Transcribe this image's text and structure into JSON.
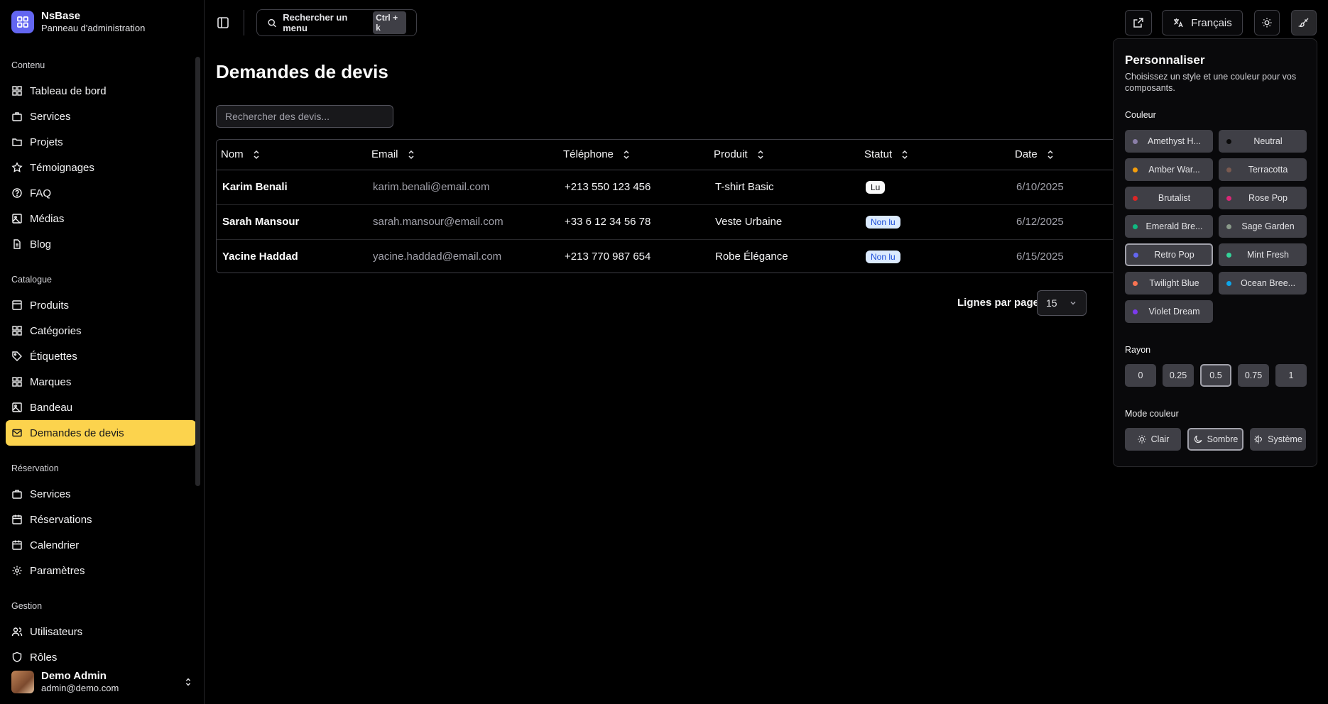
{
  "brand": {
    "title": "NsBase",
    "subtitle": "Panneau d'administration"
  },
  "nav": {
    "groups": [
      {
        "label": "Contenu",
        "items": [
          "Tableau de bord",
          "Services",
          "Projets",
          "Témoignages",
          "FAQ",
          "Médias",
          "Blog"
        ]
      },
      {
        "label": "Catalogue",
        "items": [
          "Produits",
          "Catégories",
          "Étiquettes",
          "Marques",
          "Bandeau",
          "Demandes de devis"
        ]
      },
      {
        "label": "Réservation",
        "items": [
          "Services",
          "Réservations",
          "Calendrier",
          "Paramètres"
        ]
      },
      {
        "label": "Gestion",
        "items": [
          "Utilisateurs",
          "Rôles"
        ]
      }
    ],
    "active": "Demandes de devis"
  },
  "user": {
    "name": "Demo Admin",
    "email": "admin@demo.com"
  },
  "topbar": {
    "search_label": "Rechercher un menu",
    "search_shortcut": "Ctrl + k",
    "language": "Français"
  },
  "main": {
    "title": "Demandes de devis",
    "search_placeholder": "Rechercher des devis...",
    "columns": [
      "Nom",
      "Email",
      "Téléphone",
      "Produit",
      "Statut",
      "Date"
    ],
    "rows": [
      {
        "name": "Karim Benali",
        "email": "karim.benali@email.com",
        "phone": "+213 550 123 456",
        "product": "T-shirt Basic",
        "status": "Lu",
        "date": "6/10/2025"
      },
      {
        "name": "Sarah Mansour",
        "email": "sarah.mansour@email.com",
        "phone": "+33 6 12 34 56 78",
        "product": "Veste Urbaine",
        "status": "Non lu",
        "date": "6/12/2025"
      },
      {
        "name": "Yacine Haddad",
        "email": "yacine.haddad@email.com",
        "phone": "+213 770 987 654",
        "product": "Robe Élégance",
        "status": "Non lu",
        "date": "6/15/2025"
      }
    ],
    "rows_per_page_label": "Lignes par page",
    "rows_per_page_value": "15"
  },
  "customize": {
    "title": "Personnaliser",
    "description": "Choisissez un style et une couleur pour vos composants.",
    "color_label": "Couleur",
    "colors": [
      {
        "name": "Amethyst H...",
        "dot": "#8b7fa8"
      },
      {
        "name": "Neutral",
        "dot": "#0a0a0a"
      },
      {
        "name": "Amber War...",
        "dot": "#f59e0b"
      },
      {
        "name": "Terracotta",
        "dot": "#7a5a50"
      },
      {
        "name": "Brutalist",
        "dot": "#dc2626"
      },
      {
        "name": "Rose Pop",
        "dot": "#db2777"
      },
      {
        "name": "Emerald Bre...",
        "dot": "#10b981"
      },
      {
        "name": "Sage Garden",
        "dot": "#8a9a8a"
      },
      {
        "name": "Retro Pop",
        "dot": "#6366f1"
      },
      {
        "name": "Mint Fresh",
        "dot": "#34d399"
      },
      {
        "name": "Twilight Blue",
        "dot": "#f97352"
      },
      {
        "name": "Ocean Bree...",
        "dot": "#0ea5e9"
      },
      {
        "name": "Violet Dream",
        "dot": "#7c3aed"
      }
    ],
    "selected_color": "Retro Pop",
    "radius_label": "Rayon",
    "radius_options": [
      "0",
      "0.25",
      "0.5",
      "0.75",
      "1"
    ],
    "selected_radius": "0.5",
    "mode_label": "Mode couleur",
    "modes": [
      "Clair",
      "Sombre",
      "Système"
    ],
    "selected_mode": "Sombre"
  },
  "colors": {
    "active_nav_bg": "#fcd34d",
    "accent": "#6366f1"
  }
}
